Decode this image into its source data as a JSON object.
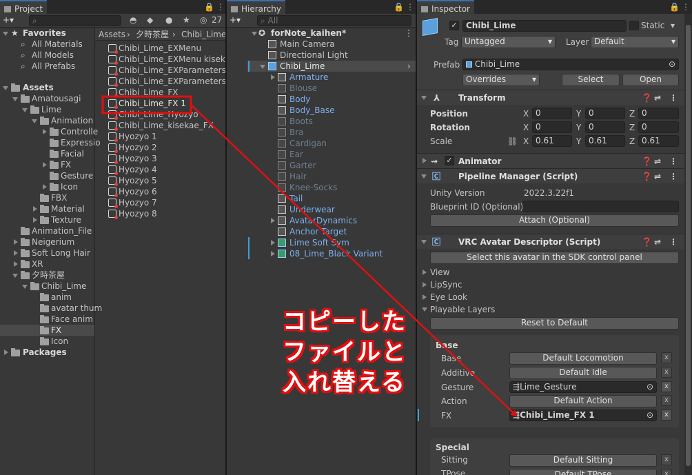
{
  "project": {
    "tab": "Project",
    "hidden_count": "27",
    "favorites": {
      "label": "Favorites",
      "items": [
        "All Materials",
        "All Models",
        "All Prefabs"
      ]
    },
    "assets_label": "Assets",
    "tree": [
      "Amatousagi",
      "Lime",
      "Animation",
      "Controlle",
      "Expressio",
      "Facial",
      "FX",
      "Gesture",
      "Icon",
      "FBX",
      "Material",
      "Texture",
      "Animation_File",
      "Neigerium",
      "Soft Long Hair",
      "XR",
      "夕時茶屋",
      "Chibi_Lime",
      "anim",
      "avatar thum",
      "Face anim",
      "FX",
      "Icon"
    ],
    "packages_label": "Packages",
    "breadcrumb": [
      "Assets",
      "夕時茶屋",
      "Chibi_Lime"
    ],
    "files": [
      "Chibi_Lime_EXMenu",
      "Chibi_Lime_EXMenu kisekae",
      "Chibi_Lime_EXParameters",
      "Chibi_Lime_EXParameters k",
      "Chibi_Lime_FX",
      "Chibi_Lime_FX 1",
      "Chibi_Lime_Hyozyo",
      "Chibi_Lime_kisekae_FX",
      "Hyozyo 1",
      "Hyozyo 2",
      "Hyozyo 3",
      "Hyozyo 4",
      "Hyozyo 5",
      "Hyozyo 6",
      "Hyozyo 7",
      "Hyozyo 8"
    ]
  },
  "hierarchy": {
    "tab": "Hierarchy",
    "search_placeholder": "All",
    "scene": "forNote_kaihen*",
    "items": [
      "Main Camera",
      "Directional Light",
      "Chibi_Lime",
      "Armature",
      "Blouse",
      "Body",
      "Body_Base",
      "Boots",
      "Bra",
      "Cardigan",
      "Ear",
      "Garter",
      "Hair",
      "Knee-Socks",
      "Tail",
      "Underwear",
      "AvatarDynamics",
      "Anchor Target",
      "Lime Soft Sym",
      "08_Lime_Black Variant"
    ]
  },
  "inspector": {
    "tab": "Inspector",
    "object_name": "Chibi_Lime",
    "static_label": "Static",
    "tag_label": "Tag",
    "tag_value": "Untagged",
    "layer_label": "Layer",
    "layer_value": "Default",
    "prefab_label": "Prefab",
    "prefab_value": "Chibi_Lime",
    "overrides": "Overrides",
    "select_btn": "Select",
    "open_btn": "Open",
    "transform": {
      "title": "Transform",
      "position_label": "Position",
      "rotation_label": "Rotation",
      "scale_label": "Scale",
      "axes": [
        "X",
        "Y",
        "Z"
      ],
      "position": [
        "0",
        "0",
        "0"
      ],
      "rotation": [
        "0",
        "0",
        "0"
      ],
      "scale": [
        "0.61",
        "0.61",
        "0.61"
      ]
    },
    "animator_title": "Animator",
    "pipeline": {
      "title": "Pipeline Manager (Script)",
      "unity_label": "Unity Version",
      "unity_value": "2022.3.22f1",
      "blueprint_label": "Blueprint ID (Optional)",
      "attach_btn": "Attach (Optional)"
    },
    "descriptor": {
      "title": "VRC Avatar Descriptor (Script)",
      "select_btn": "Select this avatar in the SDK control panel",
      "foldouts": [
        "View",
        "LipSync",
        "Eye Look",
        "Playable Layers"
      ],
      "reset_btn": "Reset to Default",
      "base_label": "Base",
      "base_rows": [
        {
          "label": "Base",
          "value": "Default Locomotion"
        },
        {
          "label": "Additive",
          "value": "Default Idle"
        },
        {
          "label": "Gesture",
          "value": "Lime_Gesture"
        },
        {
          "label": "Action",
          "value": "Default Action"
        },
        {
          "label": "FX",
          "value": "Chibi_Lime_FX 1"
        }
      ],
      "special_label": "Special",
      "special_rows": [
        {
          "label": "Sitting",
          "value": "Default Sitting"
        },
        {
          "label": "TPose",
          "value": "Default TPose"
        }
      ],
      "x": "x"
    }
  },
  "annotation": {
    "lines": [
      "コピーした",
      "ファイルと",
      "入れ替える"
    ],
    "color": "#e01010"
  }
}
